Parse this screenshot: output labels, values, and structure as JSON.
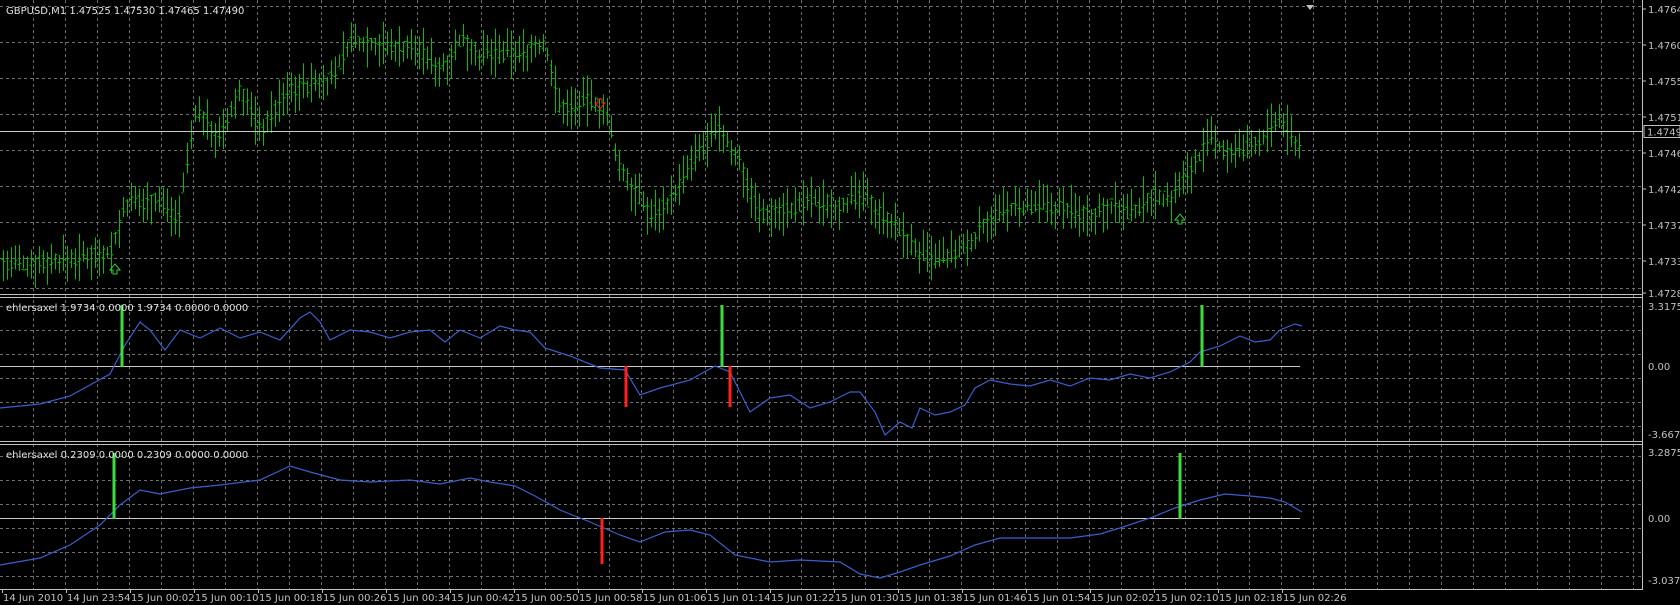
{
  "colors": {
    "background": "#000000",
    "grid": "#6e6e6e",
    "price_bars": "#00c000",
    "axis_text": "#c0c0c0",
    "indicator_line": "#3a5fcd",
    "signal_up": "#3cdc3c",
    "signal_down": "#ff2020",
    "zero_line": "#c8c8c8",
    "arrow_up": "#2ecc2e",
    "arrow_down": "#ff2020"
  },
  "main_panel": {
    "header": "GBPUSD,M1  1.47525 1.47530 1.47465 1.47490",
    "price_ticks": [
      "1.47645",
      "1.47600",
      "1.47555",
      "1.47510",
      "1.47465",
      "1.47420",
      "1.47375",
      "1.47330",
      "1.47285"
    ],
    "current_price_label": "1.47490",
    "current_price": 1.4749
  },
  "indicator1": {
    "header": "ehlersaxel 1.9734 0.0000 1.9734 0.0000 0.0000",
    "ticks": [
      "3.3175",
      "0.00",
      "-3.6671"
    ]
  },
  "indicator2": {
    "header": "ehlersaxel 0.2309 0.0000 0.2309 0.0000 0.0000",
    "ticks": [
      "3.2875",
      "0.00",
      "-3.0373"
    ]
  },
  "time_labels": [
    "14 Jun 2010",
    "14 Jun 23:54",
    "15 Jun 00:02",
    "15 Jun 00:10",
    "15 Jun 00:18",
    "15 Jun 00:26",
    "15 Jun 00:34",
    "15 Jun 00:42",
    "15 Jun 00:50",
    "15 Jun 00:58",
    "15 Jun 01:06",
    "15 Jun 01:14",
    "15 Jun 01:22",
    "15 Jun 01:30",
    "15 Jun 01:38",
    "15 Jun 01:46",
    "15 Jun 01:54",
    "15 Jun 02:02",
    "15 Jun 02:10",
    "15 Jun 02:18",
    "15 Jun 02:26"
  ]
}
